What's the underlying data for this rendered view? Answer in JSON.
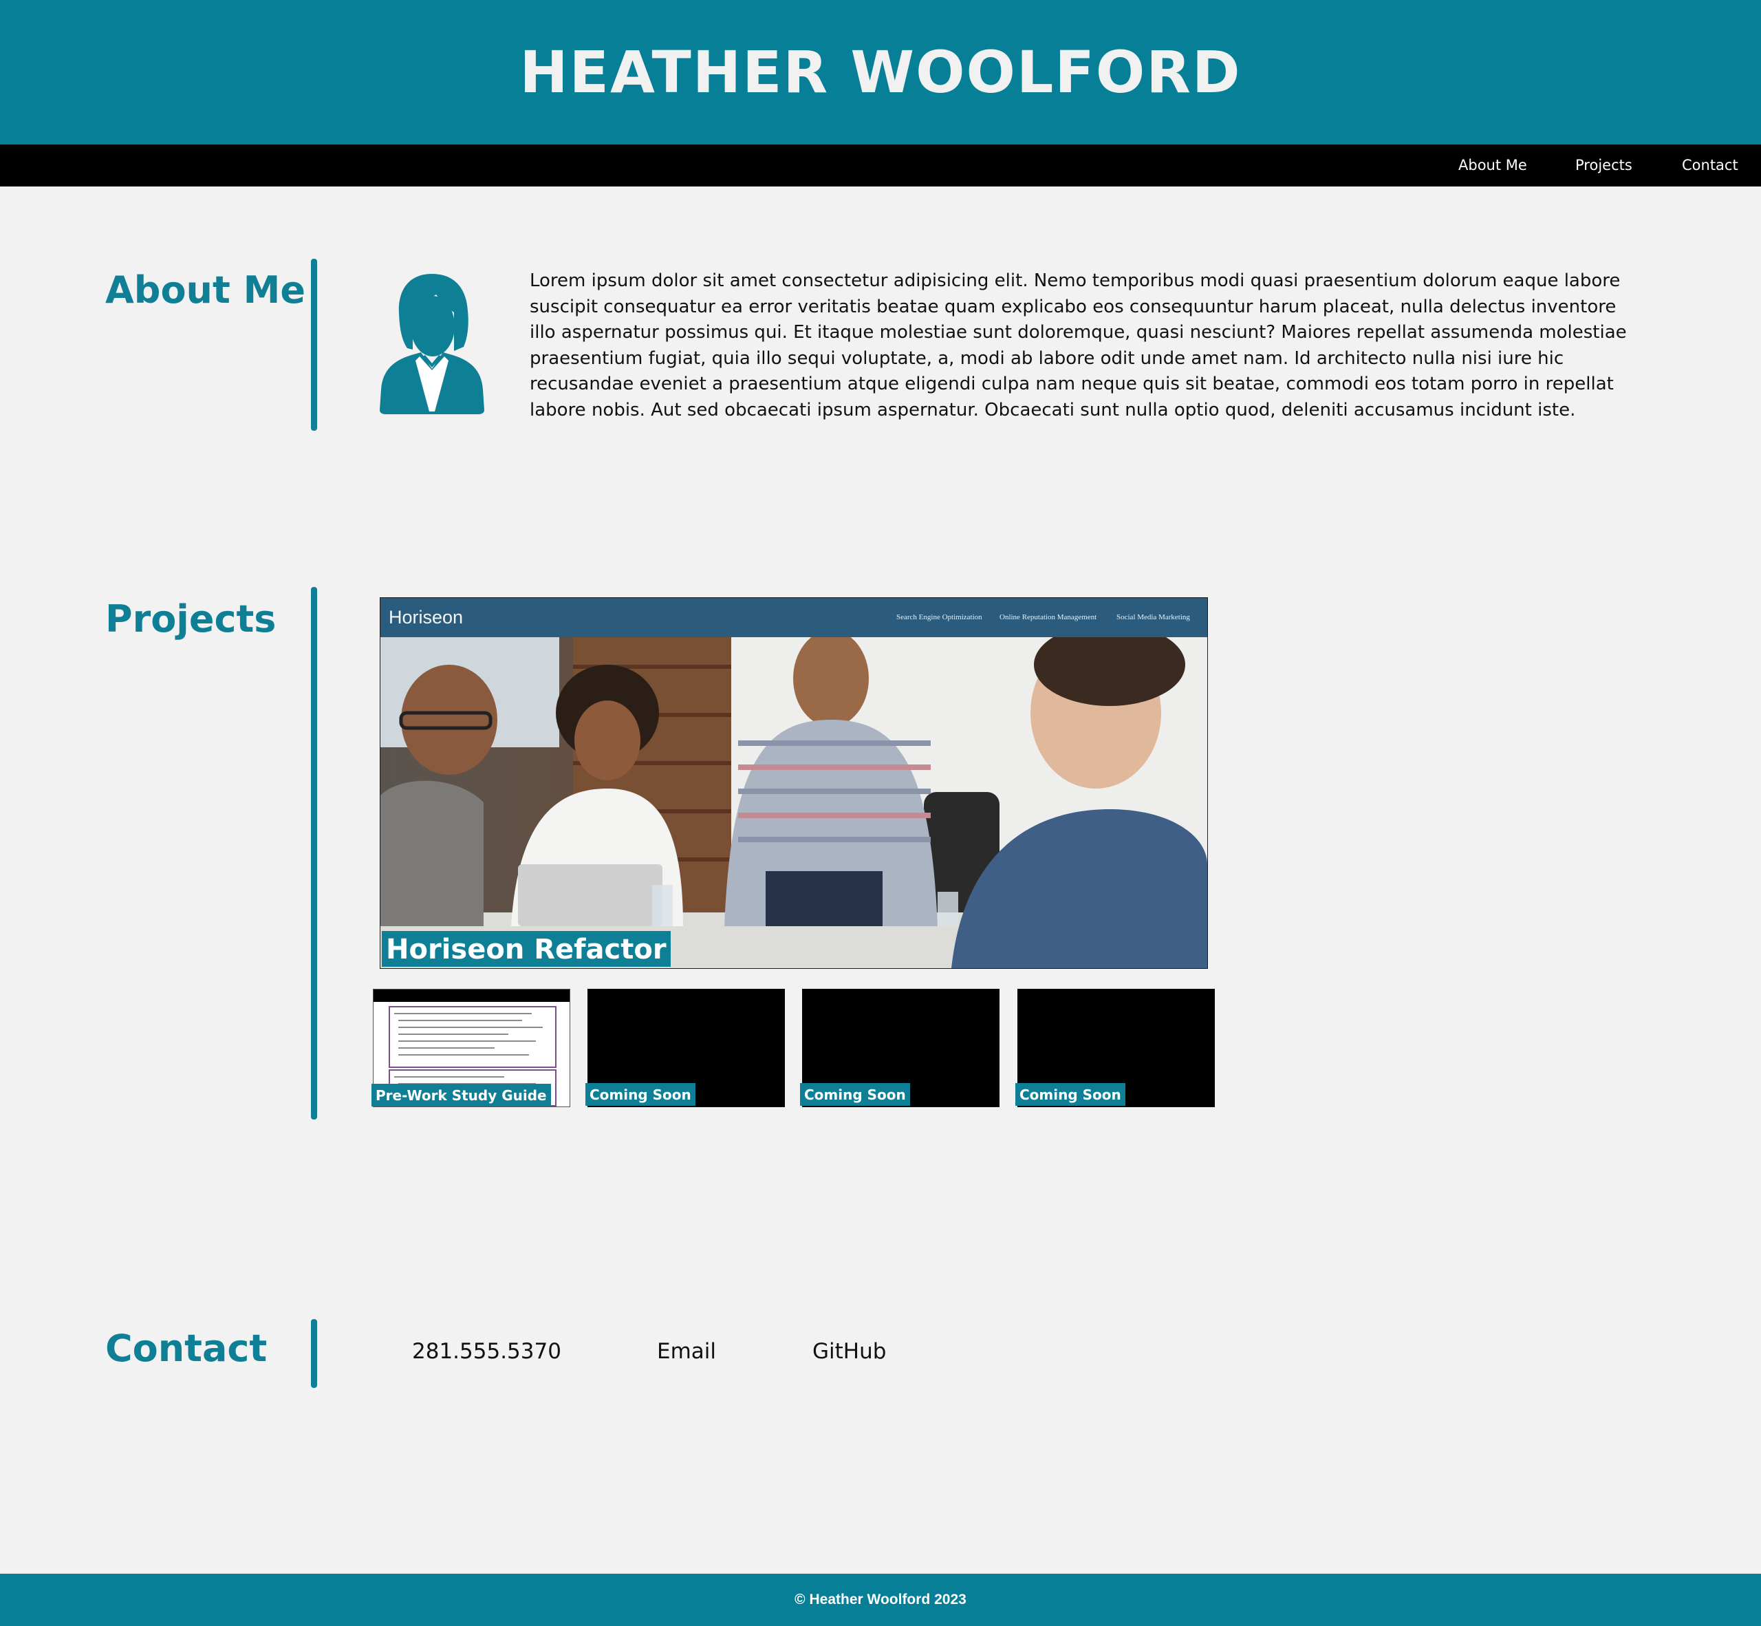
{
  "header": {
    "title": "HEATHER WOOLFORD"
  },
  "nav": {
    "about": "About Me",
    "projects": "Projects",
    "contact": "Contact"
  },
  "about": {
    "heading": "About Me",
    "avatar_icon": "person-icon",
    "text": "Lorem ipsum dolor sit amet consectetur adipisicing elit. Nemo temporibus modi quasi praesentium dolorum eaque labore suscipit consequatur ea error veritatis beatae quam explicabo eos consequuntur harum placeat, nulla delectus inventore illo aspernatur possimus qui. Et itaque molestiae sunt doloremque, quasi nesciunt? Maiores repellat assumenda molestiae praesentium fugiat, quia illo sequi voluptate, a, modi ab labore odit unde amet nam. Id architecto nulla nisi iure hic recusandae eveniet a praesentium atque eligendi culpa nam neque quis sit beatae, commodi eos totam porro in repellat labore nobis. Aut sed obcaecati ipsum aspernatur. Obcaecati sunt nulla optio quod, deleniti accusamus incidunt iste."
  },
  "projects": {
    "heading": "Projects",
    "featured": {
      "caption": "Horiseon Refactor",
      "screenshot": {
        "logo": "Horiseon",
        "nav": [
          "Search Engine Optimization",
          "Online Reputation Management",
          "Social Media Marketing"
        ]
      }
    },
    "thumbnails": [
      {
        "caption": "Pre-Work Study Guide"
      },
      {
        "caption": "Coming Soon"
      },
      {
        "caption": "Coming Soon"
      },
      {
        "caption": "Coming Soon"
      }
    ]
  },
  "contact": {
    "heading": "Contact",
    "phone": "281.555.5370",
    "email": "Email",
    "github": "GitHub"
  },
  "footer": {
    "text": "© Heather Woolford 2023"
  },
  "colors": {
    "brand": "#077f97",
    "accent": "#0e7f95",
    "nav_bg": "#000000",
    "page_bg": "#f2f2f2"
  }
}
